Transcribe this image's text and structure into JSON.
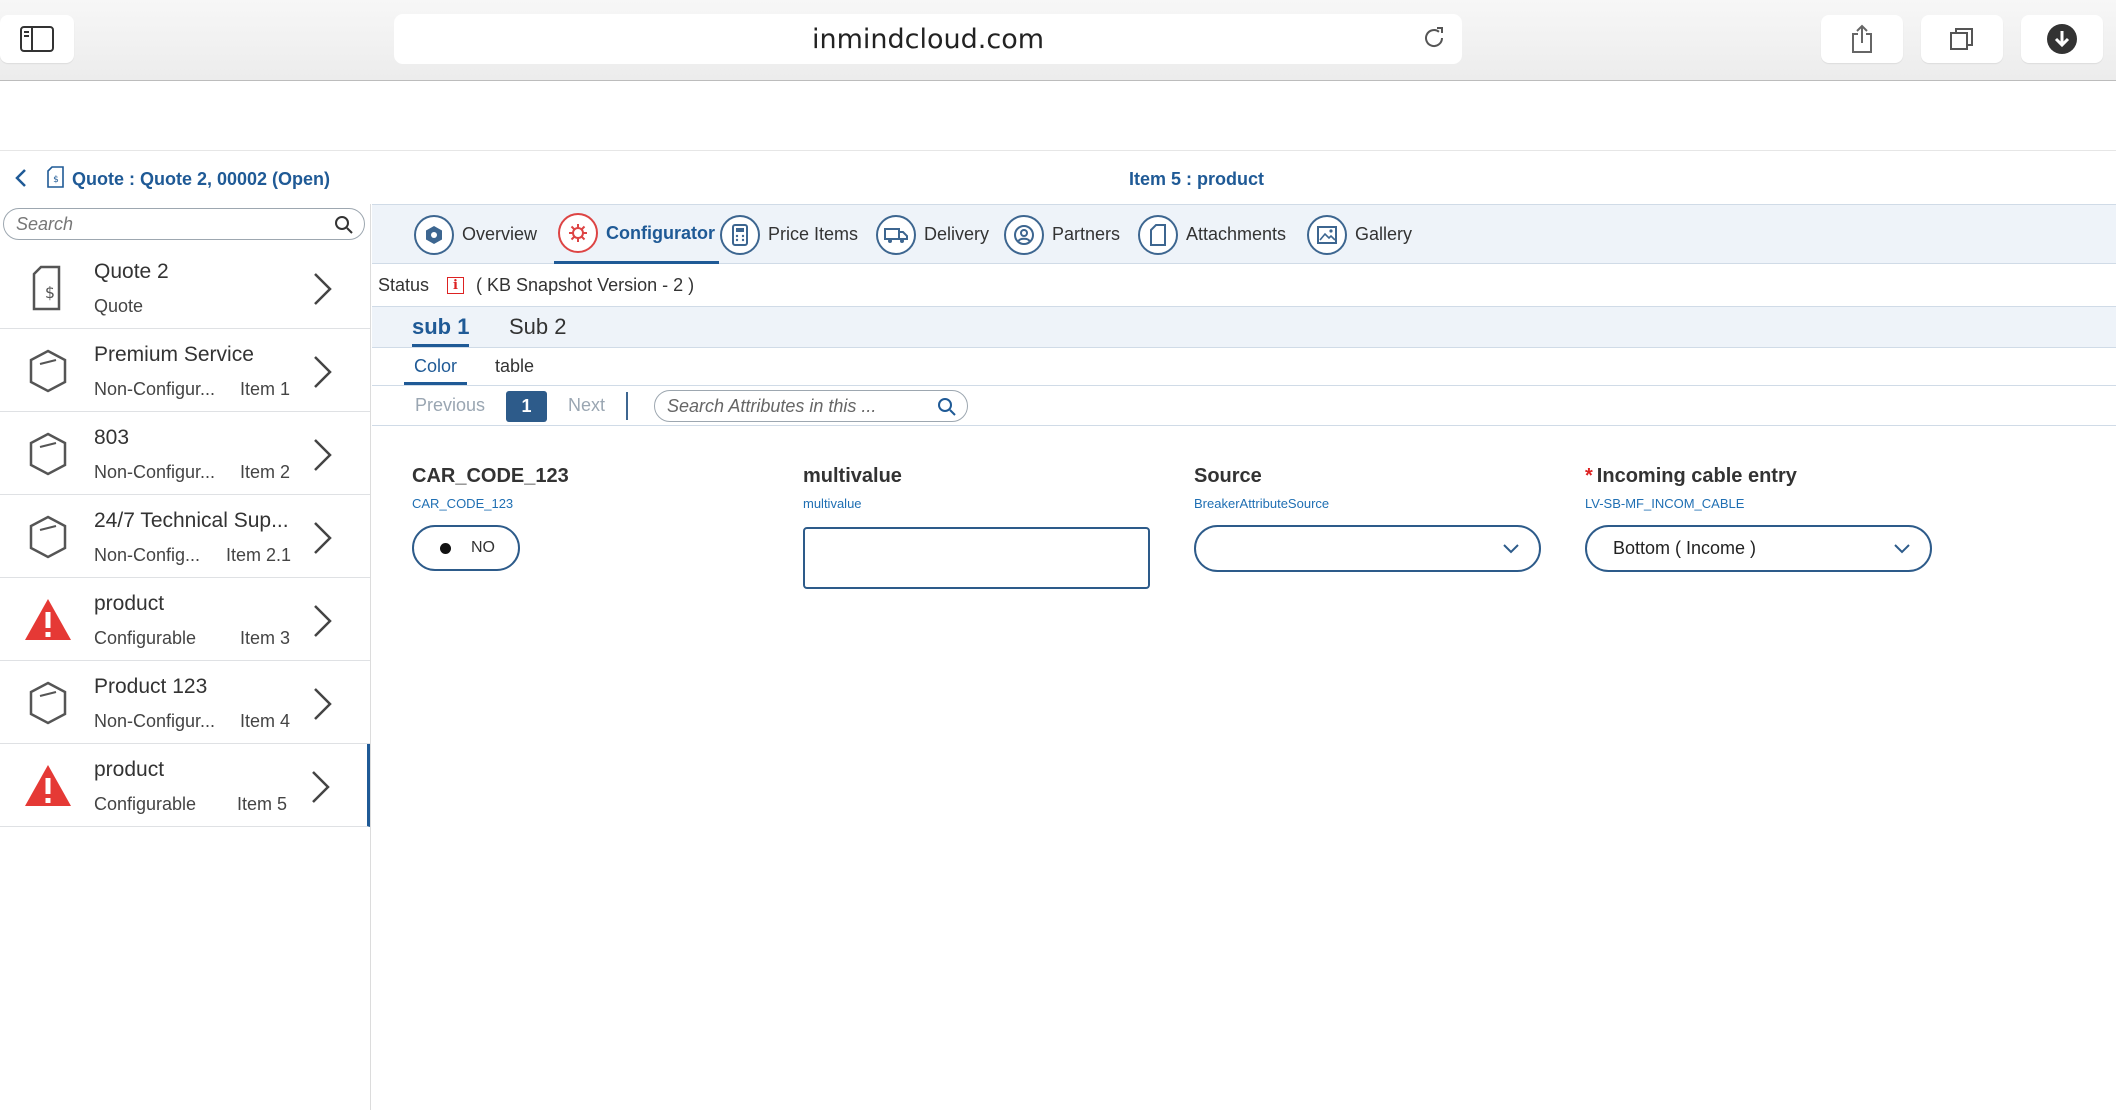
{
  "browser": {
    "url": "inmindcloud.com"
  },
  "header": {
    "breadcrumb": "Quote : Quote 2, 00002 (Open)",
    "item_title": "Item 5 : product"
  },
  "sidebar": {
    "search_placeholder": "Search",
    "items": [
      {
        "name": "Quote 2",
        "type": "Quote",
        "num": "",
        "icon": "quote-document-icon"
      },
      {
        "name": "Premium Service",
        "type": "Non-Configur...",
        "num": "Item 1",
        "icon": "product-box-icon"
      },
      {
        "name": "803",
        "type": "Non-Configur...",
        "num": "Item 2",
        "icon": "product-box-icon"
      },
      {
        "name": "24/7 Technical Sup...",
        "type": "Non-Config...",
        "num": "Item 2.1",
        "icon": "product-box-icon"
      },
      {
        "name": "product",
        "type": "Configurable",
        "num": "Item 3",
        "icon": "warning-icon"
      },
      {
        "name": "Product 123",
        "type": "Non-Configur...",
        "num": "Item 4",
        "icon": "product-box-icon"
      },
      {
        "name": "product",
        "type": "Configurable",
        "num": "Item 5",
        "icon": "warning-icon"
      }
    ]
  },
  "tabs": [
    {
      "label": "Overview",
      "icon": "overview-icon"
    },
    {
      "label": "Configurator",
      "icon": "configurator-gear-icon"
    },
    {
      "label": "Price Items",
      "icon": "calculator-icon"
    },
    {
      "label": "Delivery",
      "icon": "truck-icon"
    },
    {
      "label": "Partners",
      "icon": "person-icon"
    },
    {
      "label": "Attachments",
      "icon": "attachment-icon"
    },
    {
      "label": "Gallery",
      "icon": "image-icon"
    }
  ],
  "status": {
    "label": "Status",
    "info": "i",
    "text": "( KB Snapshot Version - 2 )"
  },
  "subtabs": [
    "sub 1",
    "Sub 2"
  ],
  "group_tabs": [
    "Color",
    "table"
  ],
  "pager": {
    "prev": "Previous",
    "page": "1",
    "next": "Next",
    "search_placeholder": "Search Attributes in this ..."
  },
  "fields": {
    "car_code": {
      "label": "CAR_CODE_123",
      "code": "CAR_CODE_123",
      "value": "NO"
    },
    "multivalue": {
      "label": "multivalue",
      "code": "multivalue",
      "value": ""
    },
    "source": {
      "label": "Source",
      "code": "BreakerAttributeSource",
      "value": ""
    },
    "cable": {
      "required": "*",
      "label": "Incoming cable entry",
      "code": "LV-SB-MF_INCOM_CABLE",
      "value": "Bottom ( Income )"
    }
  },
  "colors": {
    "accent": "#1f5a96",
    "warning": "#e53935",
    "tab_bg": "#eef3f9"
  }
}
